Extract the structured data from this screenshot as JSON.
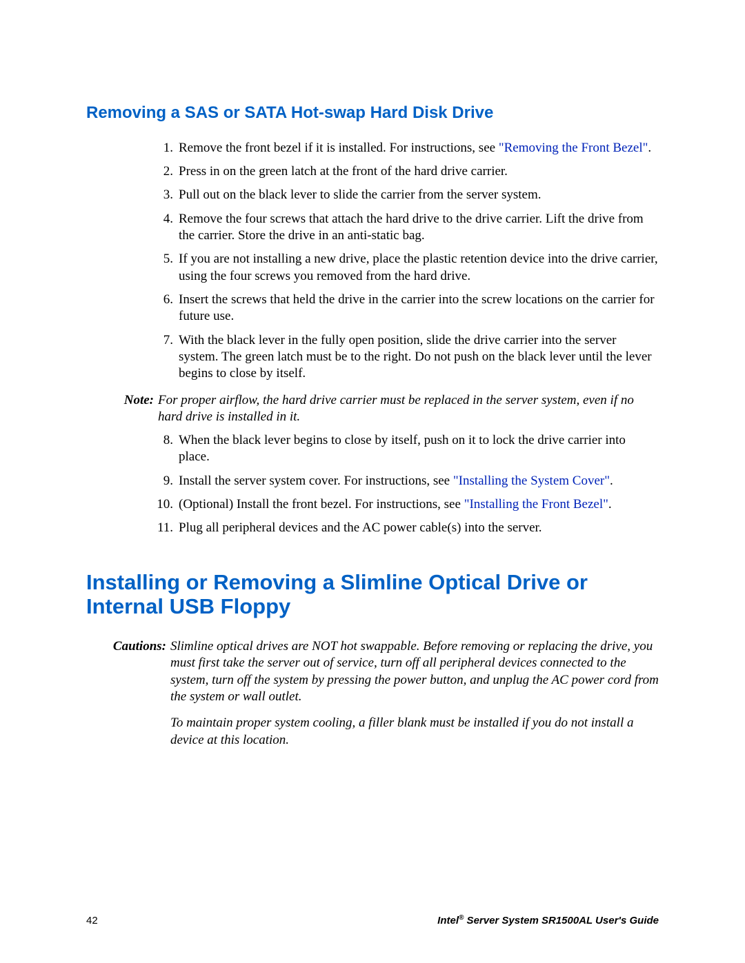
{
  "section1": {
    "heading": "Removing a SAS or SATA Hot-swap Hard Disk Drive",
    "items_a": [
      {
        "n": "1.",
        "pre": "Remove the front bezel if it is installed. For instructions, see ",
        "link": "\"Removing the Front Bezel\"",
        "post": "."
      },
      {
        "n": "2.",
        "t": "Press in on the green latch at the front of the hard drive carrier."
      },
      {
        "n": "3.",
        "t": "Pull out on the black lever to slide the carrier from the server system."
      },
      {
        "n": "4.",
        "t": "Remove the four screws that attach the hard drive to the drive carrier. Lift the drive from the carrier. Store the drive in an anti-static bag."
      },
      {
        "n": "5.",
        "t": "If you are not installing a new drive, place the plastic retention device into the drive carrier, using the four screws you removed from the hard drive."
      },
      {
        "n": "6.",
        "t": "Insert the screws that held the drive in the carrier into the screw locations on the carrier for future use."
      },
      {
        "n": "7.",
        "t": "With the black lever in the fully open position, slide the drive carrier into the server system. The green latch must be to the right. Do not push on the black lever until the lever begins to close by itself."
      }
    ],
    "note_label": "Note:",
    "note_text": "For proper airflow, the hard drive carrier must be replaced in the server system, even if no hard drive is installed in it.",
    "items_b": [
      {
        "n": "8.",
        "t": "When the black lever begins to close by itself, push on it to lock the drive carrier into place."
      },
      {
        "n": "9.",
        "pre": "Install the server system cover. For instructions, see ",
        "link": "\"Installing the System Cover\"",
        "post": "."
      },
      {
        "n": "10.",
        "pre": "(Optional) Install the front bezel. For instructions, see ",
        "link": "\"Installing the Front Bezel\"",
        "post": "."
      },
      {
        "n": "11.",
        "t": "Plug all peripheral devices and the AC power cable(s) into the server."
      }
    ]
  },
  "section2": {
    "heading": "Installing or Removing a Slimline Optical Drive or Internal USB Floppy",
    "caut_label": "Cautions:",
    "caut_p1": "Slimline optical drives are NOT hot swappable. Before removing or replacing the drive, you must first take the server out of service, turn off all peripheral devices connected to the system, turn off the system by pressing the power button, and unplug the AC power cord from the system or wall outlet.",
    "caut_p2": "To maintain proper system cooling, a filler blank must be installed if you do not install a device at this location."
  },
  "footer": {
    "page": "42",
    "guide_pre": "Intel",
    "guide_sup": "®",
    "guide_post": " Server System SR1500AL User's Guide"
  }
}
